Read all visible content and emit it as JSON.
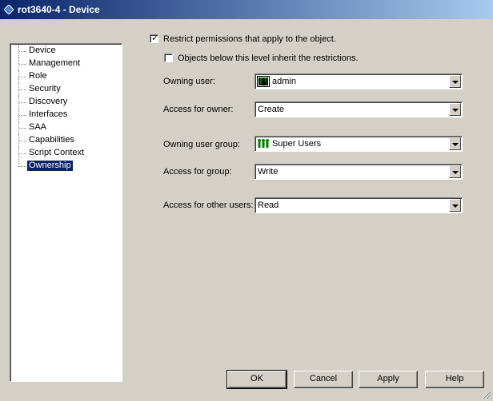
{
  "window": {
    "title": "rot3640-4 - Device"
  },
  "tree": {
    "items": [
      {
        "label": "Device",
        "selected": false
      },
      {
        "label": "Management",
        "selected": false
      },
      {
        "label": "Role",
        "selected": false
      },
      {
        "label": "Security",
        "selected": false
      },
      {
        "label": "Discovery",
        "selected": false
      },
      {
        "label": "Interfaces",
        "selected": false
      },
      {
        "label": "SAA",
        "selected": false
      },
      {
        "label": "Capabilities",
        "selected": false
      },
      {
        "label": "Script Context",
        "selected": false
      },
      {
        "label": "Ownership",
        "selected": true
      }
    ]
  },
  "ownership": {
    "restrict": {
      "label": "Restrict permissions that apply to the object.",
      "checked": true
    },
    "inherit": {
      "label": "Objects below this level inherit the restrictions.",
      "checked": false
    },
    "owning_user": {
      "label": "Owning user:",
      "value": "admin",
      "icon": "user-icon"
    },
    "access_owner": {
      "label": "Access for owner:",
      "value": "Create"
    },
    "owning_group": {
      "label": "Owning user group:",
      "value": "Super Users",
      "icon": "group-icon"
    },
    "access_group": {
      "label": "Access for group:",
      "value": "Write"
    },
    "access_other": {
      "label": "Access for other users:",
      "value": "Read"
    }
  },
  "buttons": {
    "ok": "OK",
    "cancel": "Cancel",
    "apply": "Apply",
    "help": "Help"
  }
}
